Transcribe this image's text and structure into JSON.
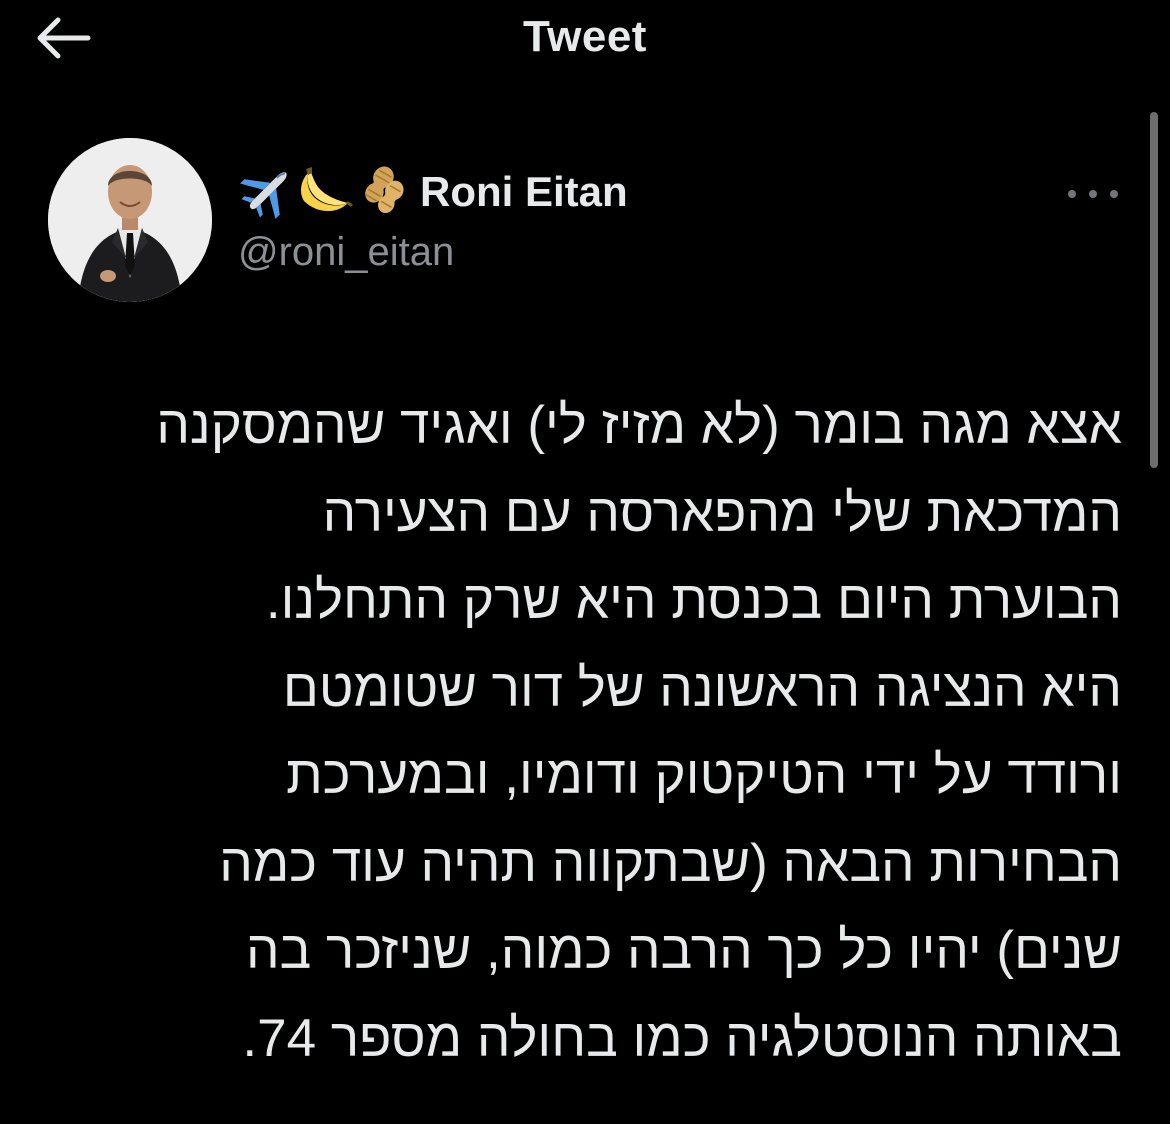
{
  "header": {
    "title": "Tweet",
    "back_icon": "arrow-left-icon"
  },
  "author": {
    "emojis": [
      "airplane",
      "banana",
      "peanuts"
    ],
    "display_name": "Roni Eitan",
    "handle": "@roni_eitan",
    "more_icon": "more-horizontal-icon"
  },
  "tweet": {
    "lines": [
      "אצא מגה בומר (לא מזיז לי) ואגיד שהמסקנה",
      "המדכאת שלי מהפארסה עם הצעירה",
      "הבוערת היום בכנסת היא שרק התחלנו.",
      "היא הנציגה הראשונה של דור שטומטם",
      "ורודד על ידי הטיקטוק ודומיו, ובמערכת",
      "הבחירות הבאה (שבתקווה תהיה עוד כמה",
      "שנים) יהיו כל כך הרבה כמוה, שניזכר בה",
      "באותה הנוסטלגיה כמו בחולה מספר 74."
    ]
  },
  "colors": {
    "background": "#000000",
    "text": "#e7e9ea",
    "secondary": "#8b9095"
  }
}
